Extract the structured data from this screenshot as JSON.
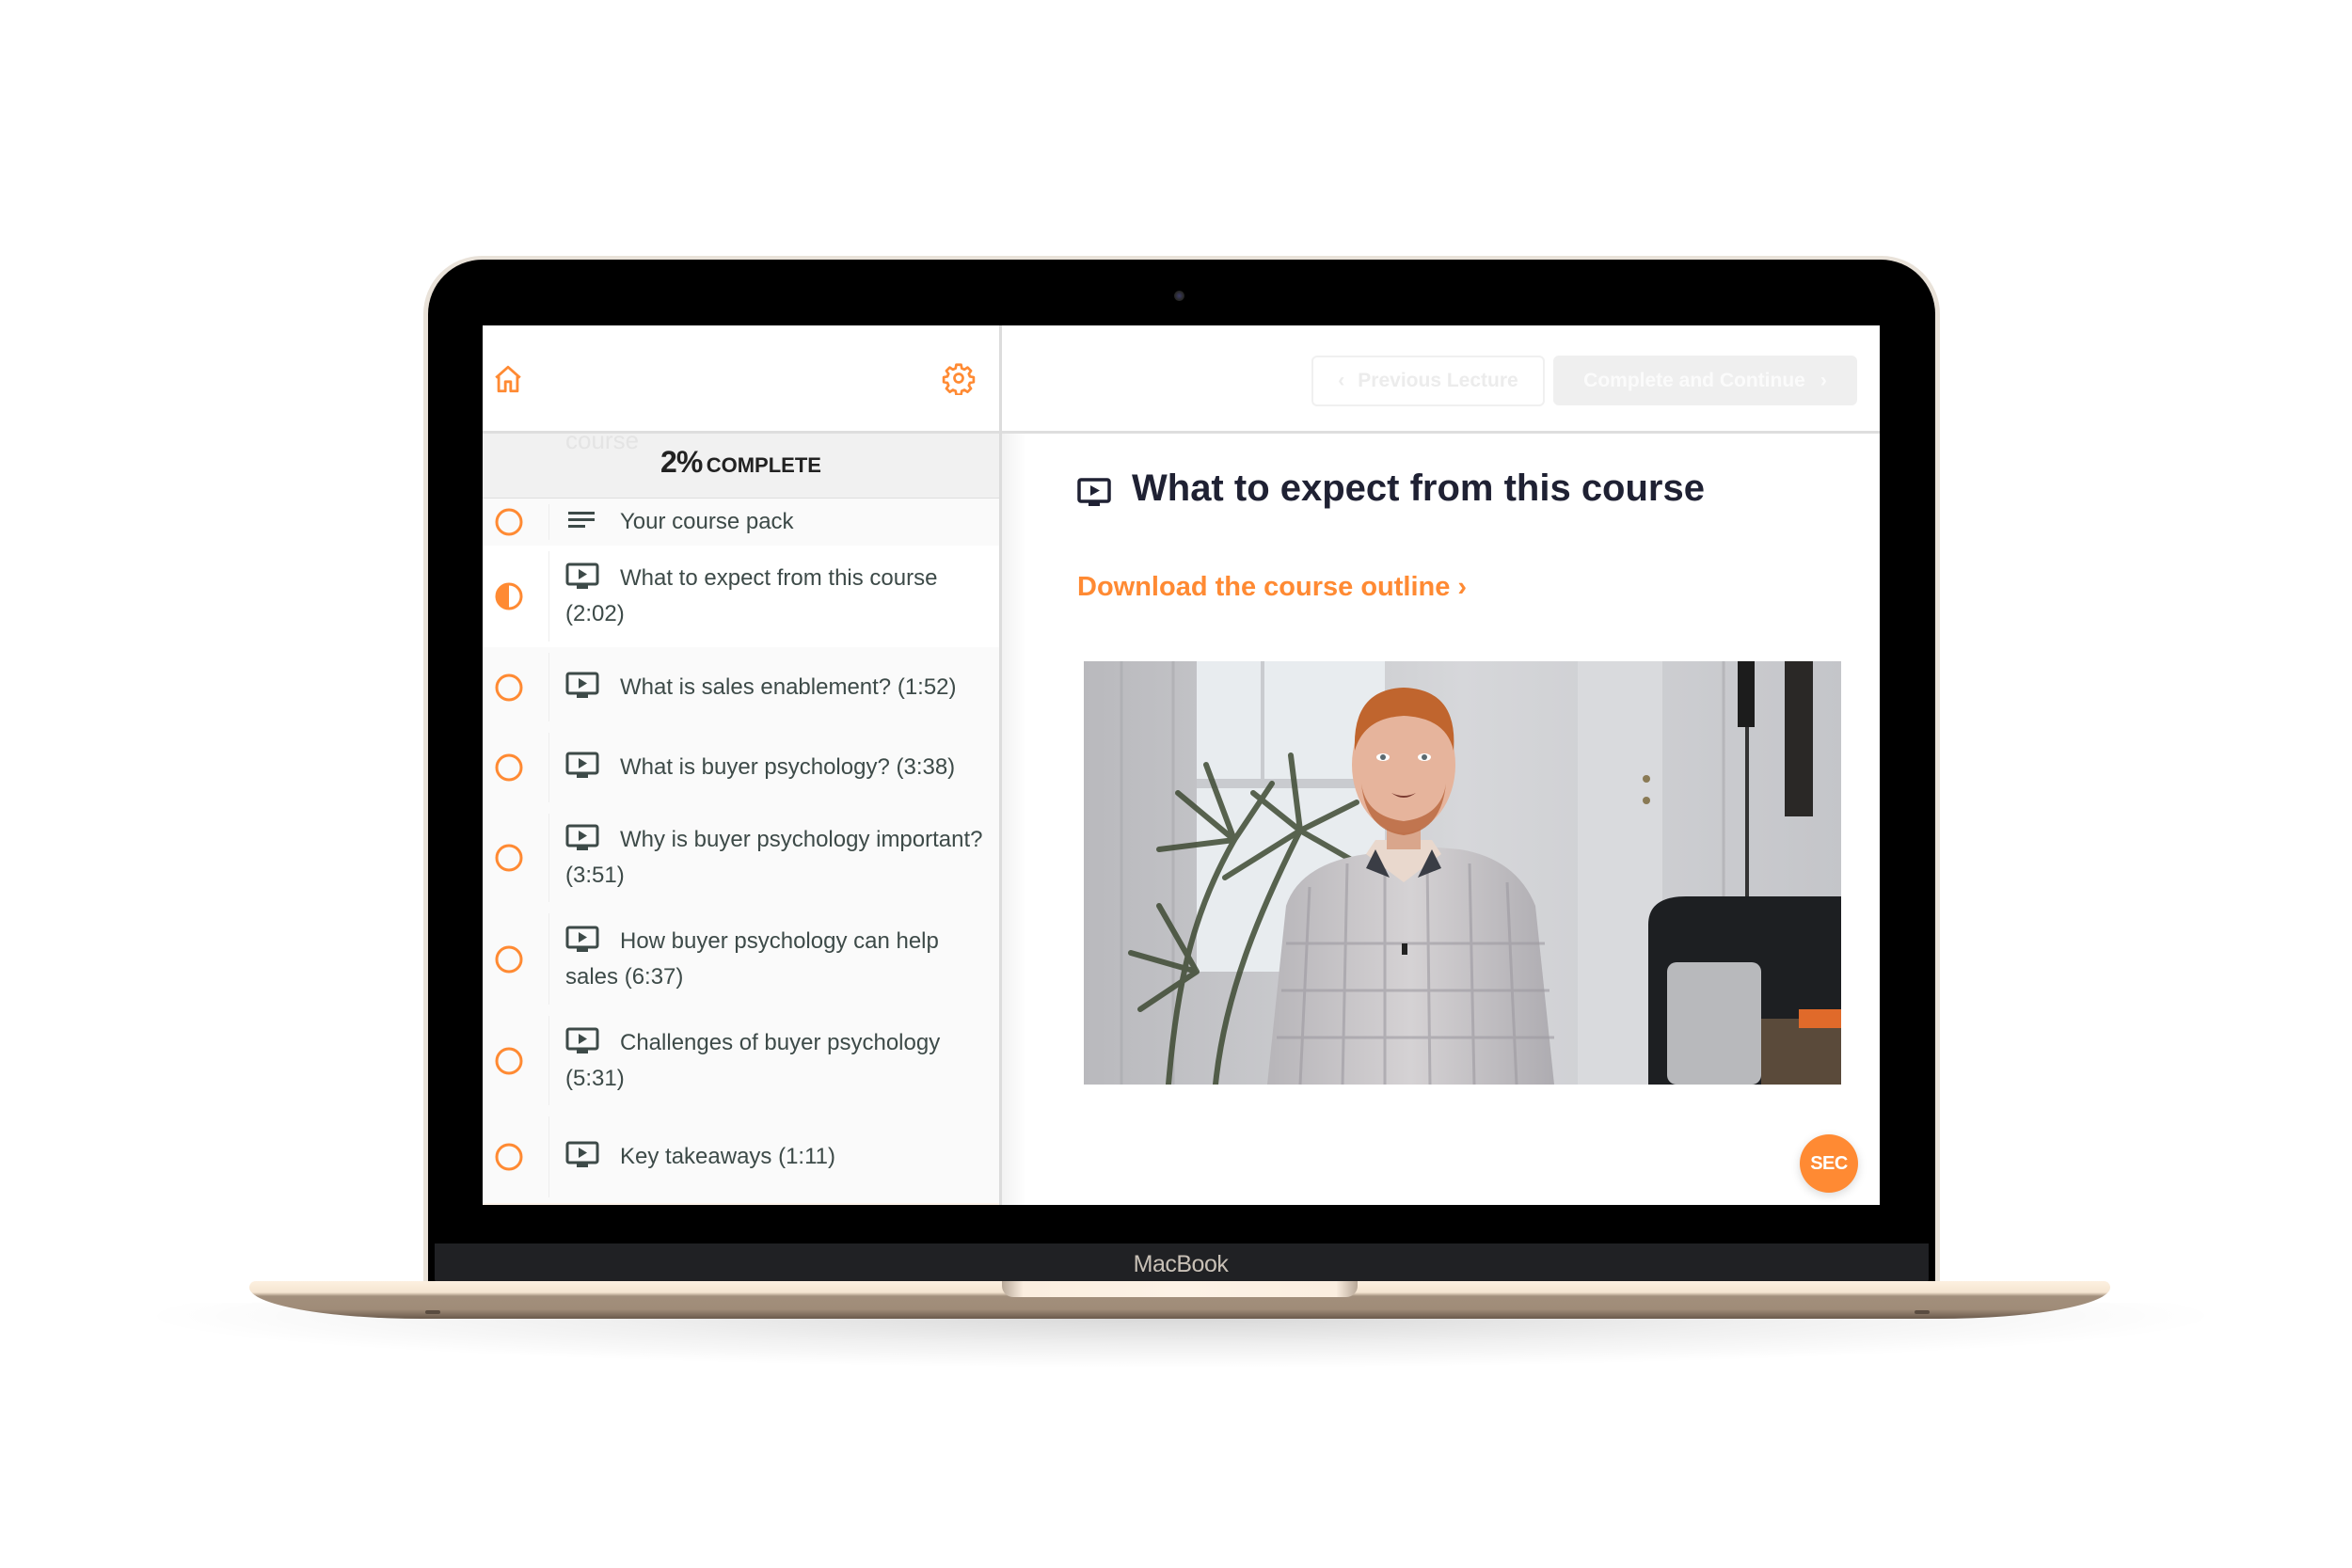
{
  "device": {
    "label": "MacBook"
  },
  "colors": {
    "accent": "#ff8a33",
    "text_dark": "#1f2133",
    "list_text": "#3d4a48"
  },
  "sidebar": {
    "home_icon": "home-icon",
    "settings_icon": "gear-icon",
    "ghost_text": "course",
    "progress": {
      "percent_label": "2%",
      "suffix": "COMPLETE",
      "value_percent": 2
    },
    "lectures": [
      {
        "title": "Your course pack",
        "type": "text",
        "icon": "text-lines-icon",
        "status": "not-started"
      },
      {
        "title": "What to expect from this course (2:02)",
        "type": "video",
        "icon": "video-icon",
        "status": "in-progress",
        "active": true
      },
      {
        "title": "What is sales enablement? (1:52)",
        "type": "video",
        "icon": "video-icon",
        "status": "not-started"
      },
      {
        "title": "What is buyer psychology? (3:38)",
        "type": "video",
        "icon": "video-icon",
        "status": "not-started"
      },
      {
        "title": "Why is buyer psychology important? (3:51)",
        "type": "video",
        "icon": "video-icon",
        "status": "not-started"
      },
      {
        "title": "How buyer psychology can help sales (6:37)",
        "type": "video",
        "icon": "video-icon",
        "status": "not-started"
      },
      {
        "title": "Challenges of buyer psychology (5:31)",
        "type": "video",
        "icon": "video-icon",
        "status": "not-started"
      },
      {
        "title": "Key takeaways (1:11)",
        "type": "video",
        "icon": "video-icon",
        "status": "not-started"
      }
    ]
  },
  "topbar": {
    "prev_label": "Previous Lecture",
    "prev_icon": "chevron-left-icon",
    "next_label": "Complete and Continue",
    "next_icon": "chevron-right-icon"
  },
  "main": {
    "title_icon": "video-icon",
    "title": "What to expect from this course",
    "download_link": "Download the course outline ›",
    "video": {
      "description": "Presenter with red hair in a plaid shirt speaking in a room with a plant, window and black lounge chair"
    },
    "badge_label": "SEC"
  }
}
